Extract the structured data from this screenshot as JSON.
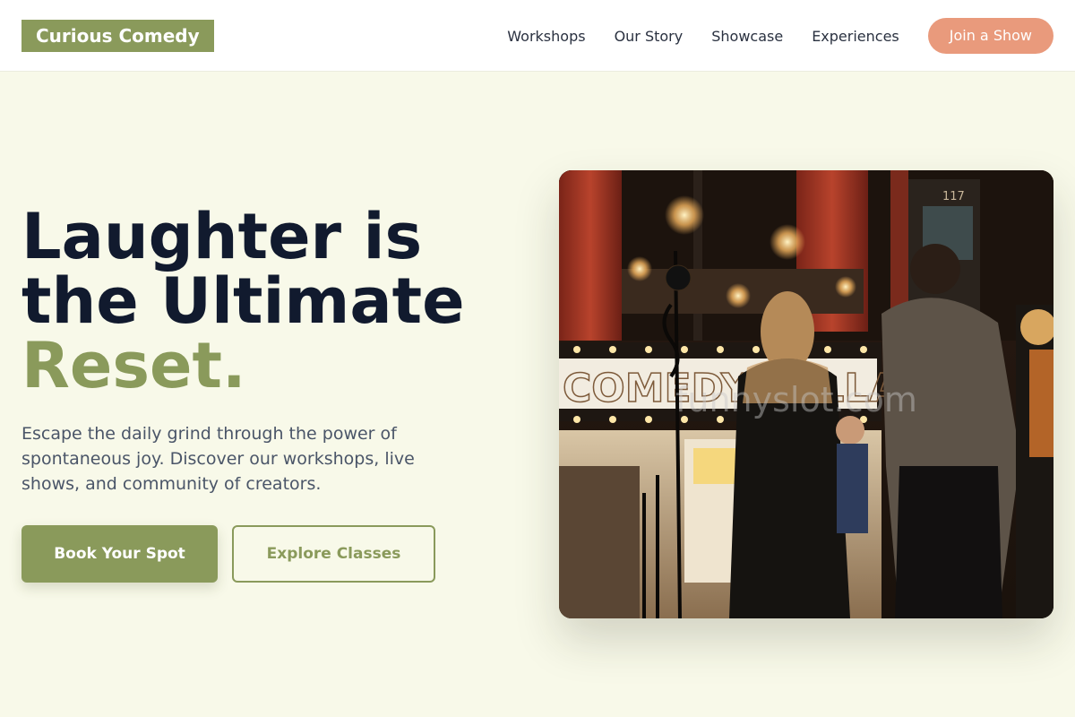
{
  "header": {
    "logo": "Curious Comedy",
    "nav": [
      {
        "label": "Workshops"
      },
      {
        "label": "Our Story"
      },
      {
        "label": "Showcase"
      },
      {
        "label": "Experiences"
      }
    ],
    "cta_label": "Join a Show"
  },
  "hero": {
    "title_line1": "Laughter is",
    "title_line2": "the Ultimate",
    "title_accent": "Reset.",
    "subtitle": "Escape the daily grind through the power of spontaneous joy. Discover our workshops, live shows, and community of creators.",
    "primary_button": "Book Your Spot",
    "secondary_button": "Explore Classes",
    "image": {
      "sign_text": "COMEDY CELLAR",
      "door_number": "117",
      "watermark": "funnyslot.com"
    }
  },
  "colors": {
    "accent_green": "#8a9a5b",
    "accent_coral": "#e99a7c",
    "background": "#f8f9e9",
    "heading": "#111a2e"
  }
}
